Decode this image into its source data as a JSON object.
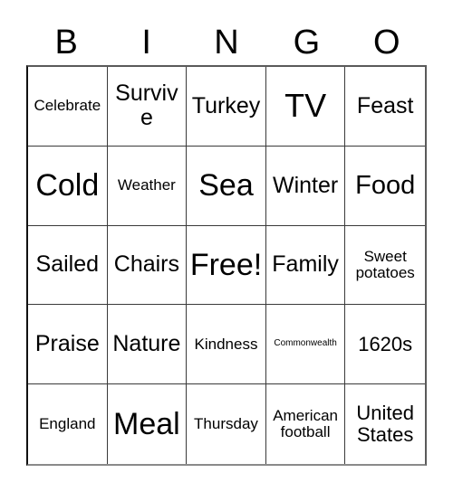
{
  "header": {
    "letters": [
      {
        "label": "B"
      },
      {
        "label": "I"
      },
      {
        "label": "N"
      },
      {
        "label": "G"
      },
      {
        "label": "O"
      }
    ]
  },
  "colors": {
    "background": "#ffffff",
    "text": "#000000",
    "grid_line": "#3a3a3a",
    "outer_border": "#111111"
  },
  "grid": {
    "rows": 5,
    "columns": 5,
    "cells": [
      {
        "label": "Celebrate",
        "size": "fs-xs"
      },
      {
        "label": "Survive",
        "size": "fs-md"
      },
      {
        "label": "Turkey",
        "size": "fs-md"
      },
      {
        "label": "TV",
        "size": "fs-xxl"
      },
      {
        "label": "Feast",
        "size": "fs-md"
      },
      {
        "label": "Cold",
        "size": "fs-xl"
      },
      {
        "label": "Weather",
        "size": "fs-xs"
      },
      {
        "label": "Sea",
        "size": "fs-xl"
      },
      {
        "label": "Winter",
        "size": "fs-md"
      },
      {
        "label": "Food",
        "size": "fs-lg"
      },
      {
        "label": "Sailed",
        "size": "fs-md"
      },
      {
        "label": "Chairs",
        "size": "fs-md"
      },
      {
        "label": "Free!",
        "size": "fs-xl"
      },
      {
        "label": "Family",
        "size": "fs-md"
      },
      {
        "label": "Sweet potatoes",
        "size": "fs-xs"
      },
      {
        "label": "Praise",
        "size": "fs-md"
      },
      {
        "label": "Nature",
        "size": "fs-md"
      },
      {
        "label": "Kindness",
        "size": "fs-xs"
      },
      {
        "label": "Commonwealth",
        "size": "fs-tiny"
      },
      {
        "label": "1620s",
        "size": "fs-sm"
      },
      {
        "label": "England",
        "size": "fs-xs"
      },
      {
        "label": "Meal",
        "size": "fs-xl"
      },
      {
        "label": "Thursday",
        "size": "fs-xs"
      },
      {
        "label": "American football",
        "size": "fs-xs"
      },
      {
        "label": "United States",
        "size": "fs-sm"
      }
    ]
  }
}
